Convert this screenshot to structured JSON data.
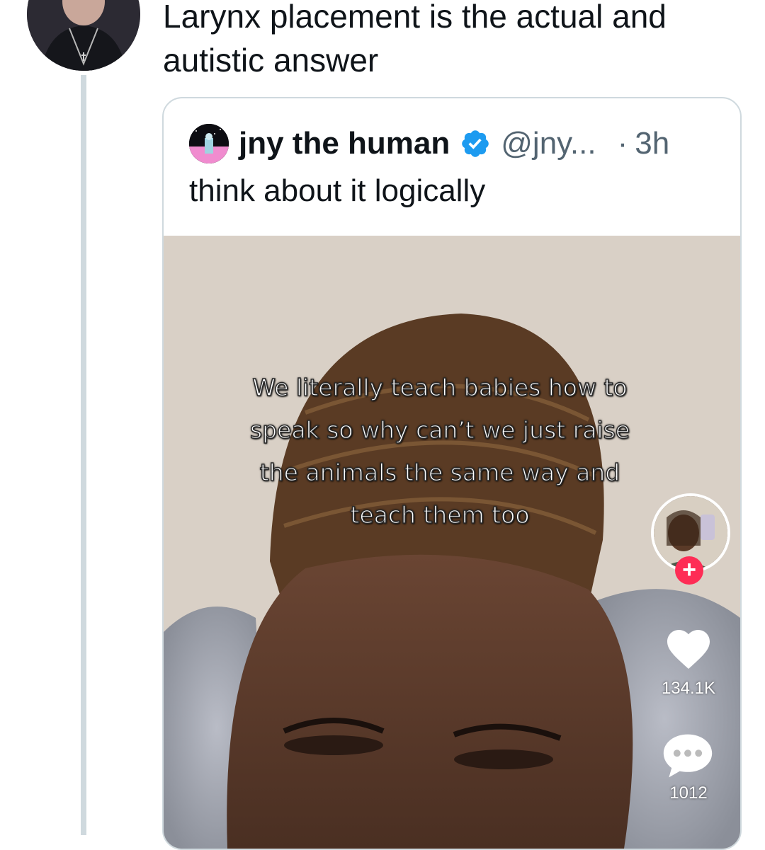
{
  "reply": {
    "text": "Larynx placement is the actual and autistic answer"
  },
  "quoted_tweet": {
    "display_name": "jny the human",
    "handle": "@jny...",
    "separator": "·",
    "time": "3h",
    "text": "think about it logically",
    "verified_icon": "verified-badge-icon",
    "verified_color": "#1d9bf0"
  },
  "video": {
    "caption": "We literally teach babies how to speak so why can’t we just raise the animals the same way and teach them too",
    "follow_label": "+",
    "like_count": "134.1K",
    "comment_count": "1012",
    "follow_color": "#fe2c55"
  }
}
